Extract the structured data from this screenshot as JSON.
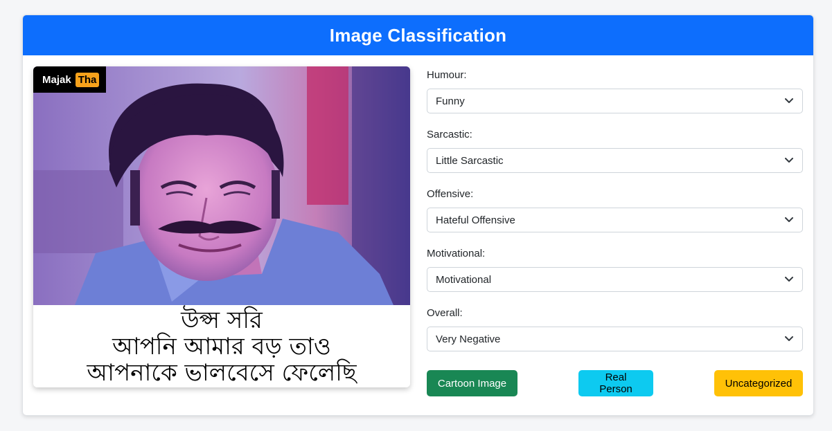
{
  "header": {
    "title": "Image Classification"
  },
  "image": {
    "brand_part1": "Majak",
    "brand_part2": "Tha",
    "caption_lines": [
      "উপ্স সরি",
      "আপনি আমার বড় তাও",
      "আপনাকে ভালবেসে ফেলেছি"
    ]
  },
  "form": {
    "fields": [
      {
        "label": "Humour:",
        "value": "Funny"
      },
      {
        "label": "Sarcastic:",
        "value": "Little Sarcastic"
      },
      {
        "label": "Offensive:",
        "value": "Hateful Offensive"
      },
      {
        "label": "Motivational:",
        "value": "Motivational"
      },
      {
        "label": "Overall:",
        "value": "Very Negative"
      }
    ]
  },
  "buttons": {
    "cartoon": "Cartoon Image",
    "real": "Real Person",
    "uncategorized": "Uncategorized"
  },
  "colors": {
    "primary": "#0d6efd",
    "success": "#198754",
    "info": "#0dcaf0",
    "warning": "#ffc107"
  },
  "icons": {
    "select_indicator": "chevron-down-icon"
  }
}
